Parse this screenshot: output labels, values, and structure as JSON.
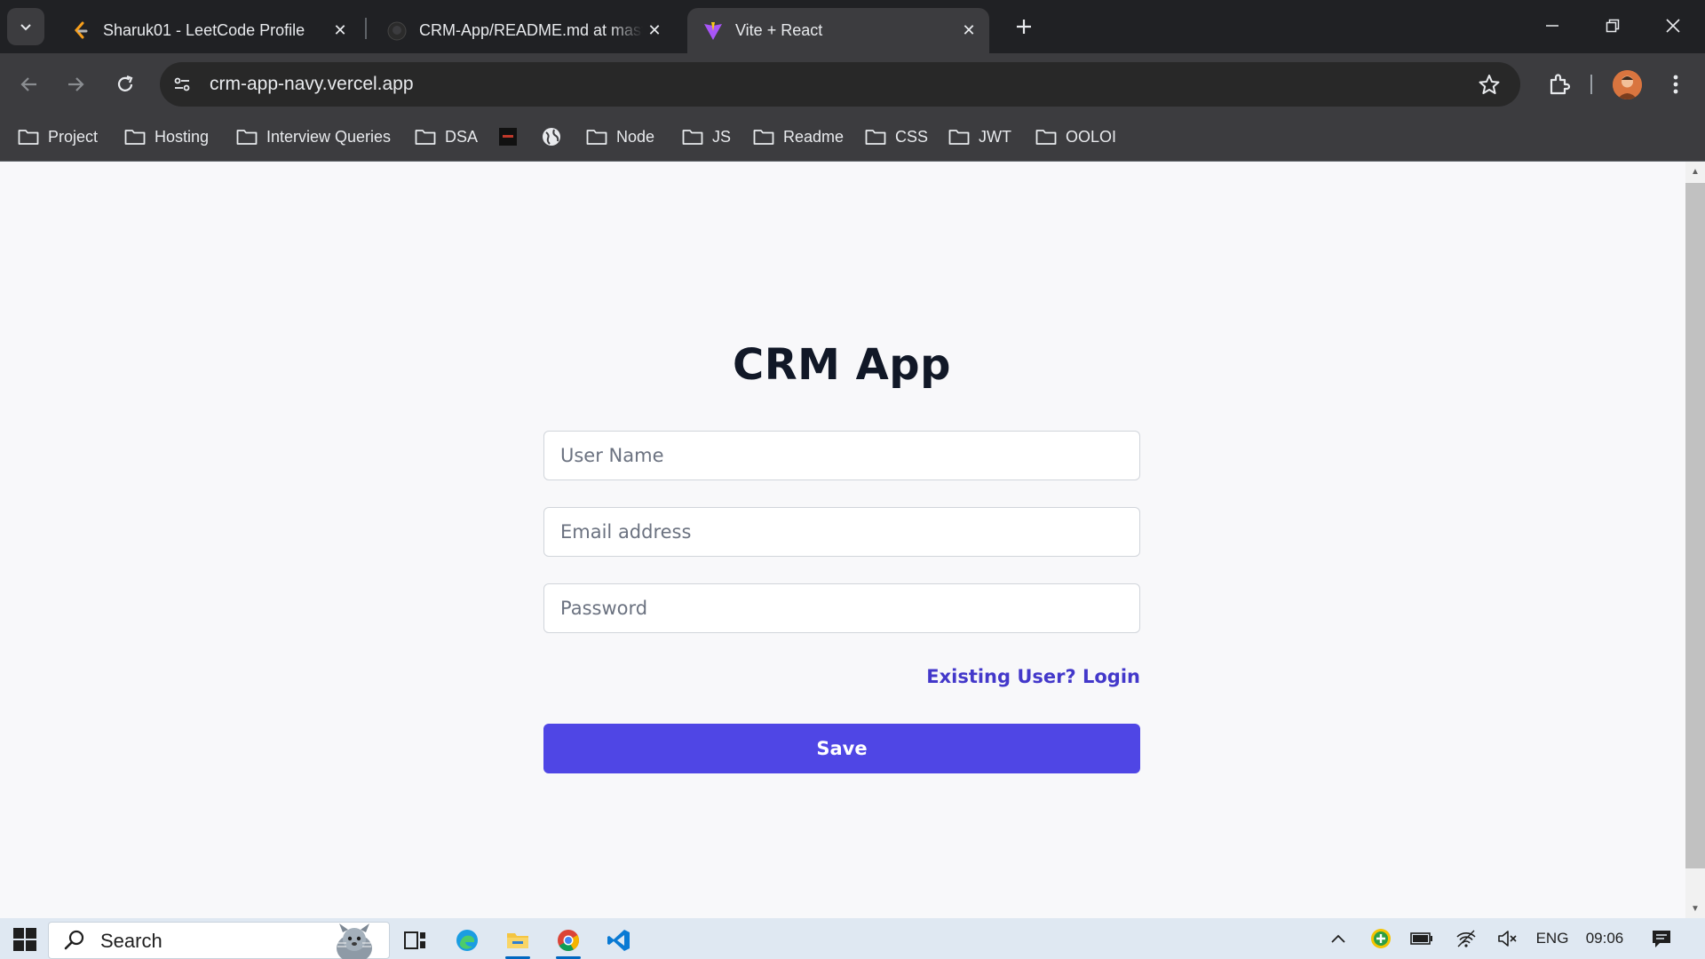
{
  "browser": {
    "tabs": [
      {
        "title": "Sharuk01 - LeetCode Profile",
        "favicon": "leetcode-icon",
        "active": false
      },
      {
        "title": "CRM-App/README.md at mast",
        "favicon": "github-icon",
        "active": false
      },
      {
        "title": "Vite + React",
        "favicon": "vite-icon",
        "active": true
      }
    ],
    "url": "crm-app-navy.vercel.app",
    "bookmarks": [
      {
        "label": "Project",
        "icon": "folder-icon"
      },
      {
        "label": "Hosting",
        "icon": "folder-icon"
      },
      {
        "label": "Interview Queries",
        "icon": "folder-icon"
      },
      {
        "label": "DSA",
        "icon": "folder-icon"
      },
      {
        "label": "",
        "icon": "site-icon"
      },
      {
        "label": "",
        "icon": "globe-icon"
      },
      {
        "label": "Node",
        "icon": "folder-icon"
      },
      {
        "label": "JS",
        "icon": "folder-icon"
      },
      {
        "label": "Readme",
        "icon": "folder-icon"
      },
      {
        "label": "CSS",
        "icon": "folder-icon"
      },
      {
        "label": "JWT",
        "icon": "folder-icon"
      },
      {
        "label": "OOLOI",
        "icon": "folder-icon"
      }
    ]
  },
  "page": {
    "title": "CRM App",
    "username_placeholder": "User Name",
    "email_placeholder": "Email address",
    "password_placeholder": "Password",
    "login_link": "Existing User? Login",
    "save_label": "Save",
    "accent_color": "#4f46e5",
    "link_color": "#4338ca"
  },
  "taskbar": {
    "search_label": "Search",
    "language": "ENG",
    "time": "09:06"
  }
}
